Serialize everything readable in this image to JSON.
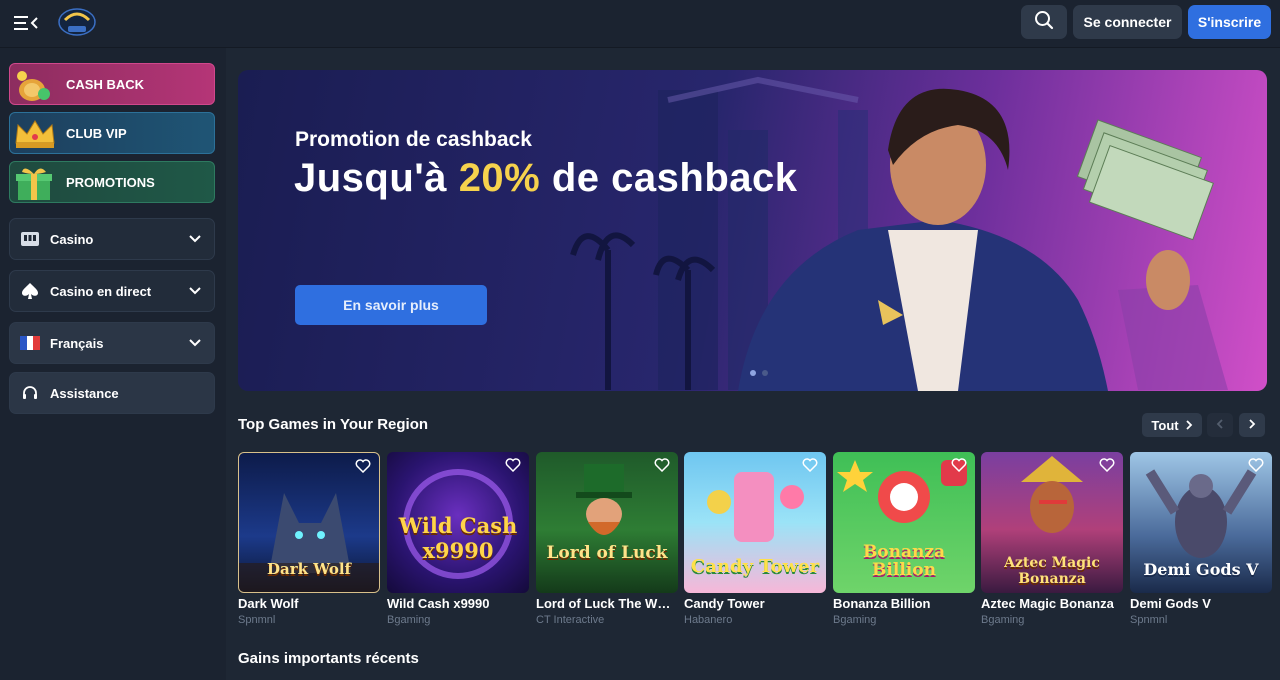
{
  "header": {
    "login_label": "Se connecter",
    "signup_label": "S'inscrire"
  },
  "sidebar": {
    "promos": [
      {
        "label": "CASH BACK"
      },
      {
        "label": "CLUB VIP"
      },
      {
        "label": "PROMOTIONS"
      }
    ],
    "items": [
      {
        "label": "Casino"
      },
      {
        "label": "Casino en direct"
      },
      {
        "label": "Français"
      },
      {
        "label": "Assistance"
      }
    ]
  },
  "banner": {
    "subtitle": "Promotion de cashback",
    "title_prefix": "Jusqu'à",
    "title_accent": "20%",
    "title_suffix": "de cashback",
    "cta_label": "En savoir plus"
  },
  "top_games": {
    "title": "Top Games in Your Region",
    "see_all_label": "Tout",
    "games": [
      {
        "name": "Dark Wolf",
        "provider": "Spnmnl",
        "art": "Dark Wolf"
      },
      {
        "name": "Wild Cash x9990",
        "provider": "Bgaming",
        "art": "Wild Cash x9990"
      },
      {
        "name": "Lord of Luck The Wheel",
        "provider": "CT Interactive",
        "art": "Lord of Luck"
      },
      {
        "name": "Candy Tower",
        "provider": "Habanero",
        "art": "Candy Tower"
      },
      {
        "name": "Bonanza Billion",
        "provider": "Bgaming",
        "art": "Bonanza Billion"
      },
      {
        "name": "Aztec Magic Bonanza",
        "provider": "Bgaming",
        "art": "Aztec Magic Bonanza"
      },
      {
        "name": "Demi Gods V",
        "provider": "Spnmnl",
        "art": "Demi Gods V"
      }
    ]
  },
  "recent_wins": {
    "title": "Gains importants récents"
  },
  "colors": {
    "accent": "#2f6fe0",
    "highlight": "#f6d24d",
    "background": "#1e2734"
  }
}
